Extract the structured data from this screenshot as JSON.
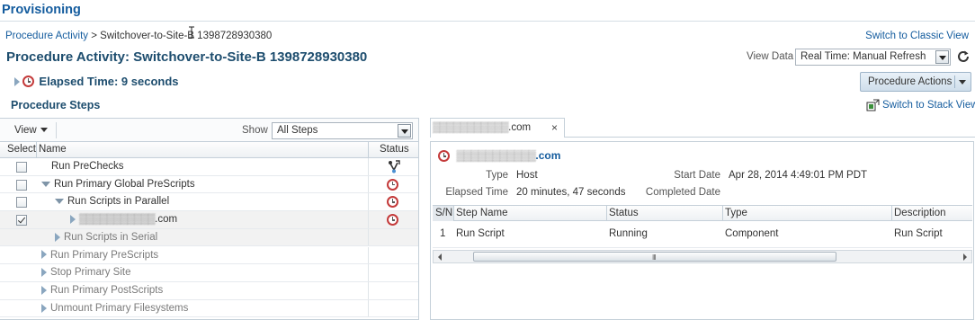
{
  "app": {
    "title": "Provisioning"
  },
  "breadcrumb": {
    "parent": "Procedure Activity",
    "separator": ">",
    "current": "Switchover-to-Site-B 1398728930380"
  },
  "links": {
    "switch_classic": "Switch to Classic View",
    "switch_stack": "Switch to Stack View"
  },
  "page": {
    "title": "Procedure Activity: Switchover-to-Site-B 1398728930380"
  },
  "view_data": {
    "label": "View Data",
    "selected": "Real Time: Manual Refresh"
  },
  "elapsed": {
    "text": "Elapsed Time: 9 seconds"
  },
  "actions": {
    "procedure_actions": "Procedure Actions"
  },
  "steps": {
    "section_title": "Procedure Steps",
    "view_menu": "View",
    "show_label": "Show",
    "show_selected": "All Steps",
    "columns": {
      "select": "Select",
      "name": "Name",
      "status": "Status"
    },
    "rows": [
      {
        "name": "Run PreChecks",
        "status_icon": "branch-icon",
        "checked": false,
        "level": 0,
        "expander": "none"
      },
      {
        "name": "Run Primary Global PreScripts",
        "status_icon": "clock-icon",
        "checked": false,
        "level": 0,
        "expander": "expanded"
      },
      {
        "name": "Run Scripts in Parallel",
        "status_icon": "clock-icon",
        "checked": false,
        "level": 1,
        "expander": "expanded"
      },
      {
        "name_blur": "▒▒▒▒▒▒▒▒▒▒▒",
        "name_suffix": ".com",
        "status_icon": "clock-icon",
        "checked": true,
        "level": 2,
        "expander": "collapsed"
      },
      {
        "name": "Run Scripts in Serial",
        "level": 1,
        "expander": "collapsed"
      },
      {
        "name": "Run Primary PreScripts",
        "level": 0,
        "expander": "collapsed"
      },
      {
        "name": "Stop Primary Site",
        "level": 0,
        "expander": "collapsed"
      },
      {
        "name": "Run Primary PostScripts",
        "level": 0,
        "expander": "collapsed"
      },
      {
        "name": "Unmount Primary Filesystems",
        "level": 0,
        "expander": "collapsed"
      }
    ]
  },
  "detail": {
    "tab": {
      "blur": "▒▒▒▒▒▒▒▒▒▒▒",
      "suffix": ".com",
      "close": "×"
    },
    "host": {
      "blur": "▒▒▒▒▒▒▒▒▒▒▒",
      "suffix": ".com"
    },
    "type_label": "Type",
    "type_value": "Host",
    "start_label": "Start Date",
    "start_value": "Apr 28, 2014 4:49:01 PM PDT",
    "elapsed_label": "Elapsed Time",
    "elapsed_value": "20 minutes, 47 seconds",
    "completed_label": "Completed Date",
    "completed_value": "",
    "grid": {
      "columns": [
        "S/N",
        "Step Name",
        "Status",
        "Type",
        "Description"
      ],
      "rows": [
        {
          "sn": "1",
          "step_name": "Run Script",
          "status": "Running",
          "type": "Component",
          "description": "Run Script"
        }
      ]
    },
    "scrollbar_grip": "III"
  },
  "colors": {
    "link": "#145c9e",
    "heading": "#1d4d6e",
    "clock": "#c43b3b"
  }
}
